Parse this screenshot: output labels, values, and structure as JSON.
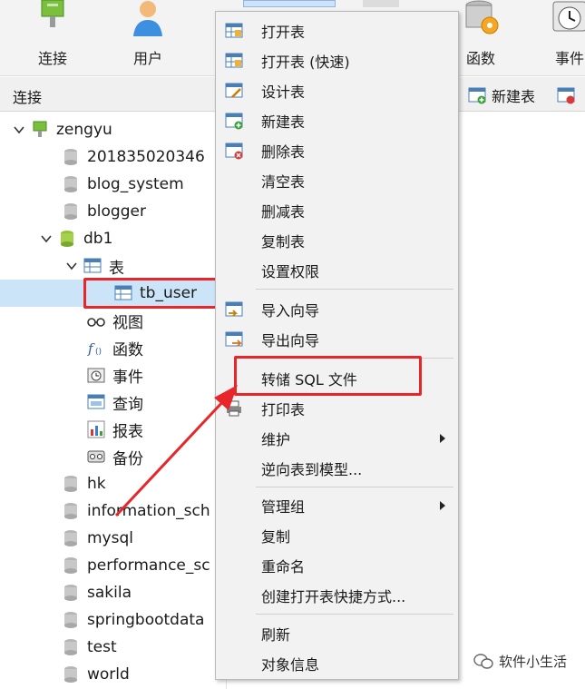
{
  "toolbar": {
    "connect": "连接",
    "user": "用户",
    "function": "函数",
    "event": "事件"
  },
  "subbar": {
    "connection_label": "连接",
    "new_table": "新建表"
  },
  "tree": {
    "connection": "zengyu",
    "databases_top": [
      "201835020346",
      "blog_system",
      "blogger"
    ],
    "db1": "db1",
    "tables_group": "表",
    "tb_user": "tb_user",
    "views": "视图",
    "functions": "函数",
    "events": "事件",
    "queries": "查询",
    "reports": "报表",
    "backups": "备份",
    "databases_bottom": [
      "hk",
      "information_sch",
      "mysql",
      "performance_sc",
      "sakila",
      "springbootdata",
      "test",
      "world"
    ]
  },
  "menu": {
    "open_table": "打开表",
    "open_table_fast": "打开表 (快速)",
    "design_table": "设计表",
    "new_table": "新建表",
    "delete_table": "删除表",
    "empty_table": "清空表",
    "truncate_table": "删减表",
    "copy_table": "复制表",
    "set_permissions": "设置权限",
    "import_wizard": "导入向导",
    "export_wizard": "导出向导",
    "dump_sql": "转储 SQL 文件",
    "print_table": "打印表",
    "maintain": "维护",
    "reverse_model": "逆向表到模型...",
    "manage_group": "管理组",
    "copy": "复制",
    "rename": "重命名",
    "create_shortcut": "创建打开表快捷方式...",
    "refresh": "刷新",
    "object_info": "对象信息"
  },
  "watermark": "软件小生活",
  "colors": {
    "highlight": "#e8262a",
    "selection": "#cce4f7"
  }
}
